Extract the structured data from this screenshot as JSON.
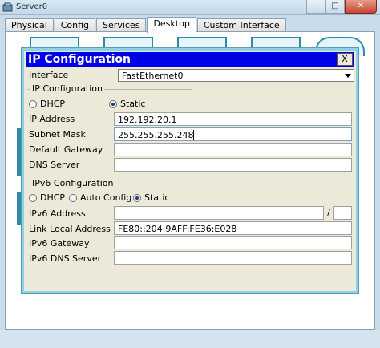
{
  "window": {
    "title": "Server0"
  },
  "tabs": [
    "Physical",
    "Config",
    "Services",
    "Desktop",
    "Custom Interface"
  ],
  "active_tab": "Desktop",
  "dialog": {
    "title": "IP Configuration",
    "close_label": "X",
    "interface_label": "Interface",
    "interface_value": "FastEthernet0",
    "ipv4": {
      "group_label": "IP Configuration",
      "dhcp_label": "DHCP",
      "static_label": "Static",
      "mode": "Static",
      "ip_address_label": "IP Address",
      "ip_address_value": "192.192.20.1",
      "subnet_mask_label": "Subnet Mask",
      "subnet_mask_value": "255.255.255.248",
      "default_gateway_label": "Default Gateway",
      "default_gateway_value": "",
      "dns_server_label": "DNS Server",
      "dns_server_value": ""
    },
    "ipv6": {
      "group_label": "IPv6 Configuration",
      "dhcp_label": "DHCP",
      "auto_config_label": "Auto Config",
      "static_label": "Static",
      "mode": "Static",
      "ipv6_address_label": "IPv6 Address",
      "ipv6_address_value": "",
      "prefix_separator": "/",
      "prefix_value": "",
      "link_local_label": "Link Local Address",
      "link_local_value": "FE80::204:9AFF:FE36:E028",
      "ipv6_gateway_label": "IPv6 Gateway",
      "ipv6_gateway_value": "",
      "ipv6_dns_label": "IPv6 DNS Server",
      "ipv6_dns_value": ""
    }
  },
  "colors": {
    "dialog_title_bg": "#0000e6",
    "desktop_accent": "#2e8ba8"
  }
}
